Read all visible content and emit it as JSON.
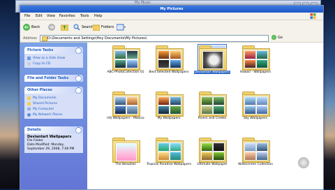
{
  "bg_window": {
    "title": "My Music"
  },
  "window": {
    "title": "My Pictures"
  },
  "menu": [
    "File",
    "Edit",
    "View",
    "Favorites",
    "Tools",
    "Help"
  ],
  "toolbar": {
    "back": "Back",
    "search": "Search",
    "folders": "Folders"
  },
  "address": {
    "label": "Address",
    "value": "D:\\Documents and Settings\\Hoy Documents\\My Pictures\\",
    "go": "Go"
  },
  "sidebar": {
    "picture_tasks": {
      "title": "Picture Tasks",
      "items": [
        "View as a slide show",
        "Copy to CD"
      ]
    },
    "file_tasks": {
      "title": "File and Folder Tasks"
    },
    "other_places": {
      "title": "Other Places",
      "items": [
        "My Documents",
        "Shared Pictures",
        "My Computer",
        "My Network Places"
      ]
    },
    "details": {
      "title": "Details",
      "name": "Deviantart Wallpapers",
      "type": "File Folder",
      "modified": "Date Modified: Monday,",
      "date": "September 29, 2008, 7:00 PM"
    }
  },
  "folders": [
    "ABC-PhotoCollection 01",
    "Best Selected Wallpapers",
    "Deviantart Wallpapers",
    "Hawaii - Wallpapers",
    "HQ Wallpapers - Mexico",
    "My Wallpapers",
    "Rivers and Creeks",
    "Sky Wallpapers",
    "The Beauties",
    "Tropical Paradise Wallpapers",
    "Ultimate Wallpaper",
    "Widescreen Collection"
  ],
  "colors": {
    "title_blue": "#1e57c8",
    "sidebar_link": "#215dc6",
    "selection": "#316ac5",
    "folder_yellow": "#f1cf5a"
  }
}
